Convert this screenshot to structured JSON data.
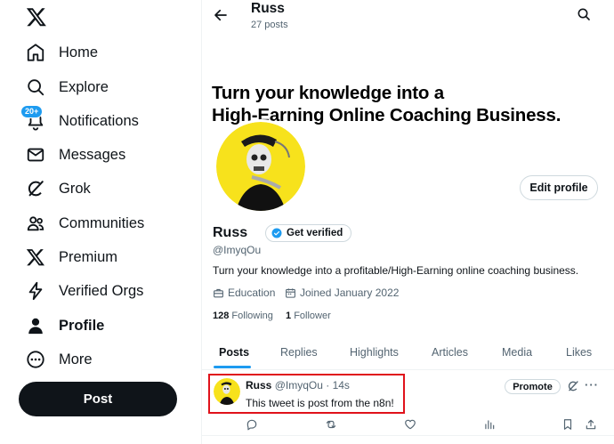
{
  "sidebar": {
    "logo_icon": "x-logo-icon",
    "items": [
      {
        "label": "Home",
        "icon": "home-icon"
      },
      {
        "label": "Explore",
        "icon": "search-icon"
      },
      {
        "label": "Notifications",
        "icon": "bell-icon",
        "badge": "20+"
      },
      {
        "label": "Messages",
        "icon": "envelope-icon"
      },
      {
        "label": "Grok",
        "icon": "grok-icon"
      },
      {
        "label": "Communities",
        "icon": "people-icon"
      },
      {
        "label": "Premium",
        "icon": "x-logo-icon"
      },
      {
        "label": "Verified Orgs",
        "icon": "lightning-icon"
      },
      {
        "label": "Profile",
        "icon": "person-icon"
      },
      {
        "label": "More",
        "icon": "more-circle-icon"
      }
    ],
    "post_label": "Post"
  },
  "header": {
    "name": "Russ",
    "post_count": "27 posts"
  },
  "banner": {
    "line1": "Turn your knowledge into a",
    "line2": "High-Earning Online Coaching Business."
  },
  "profile": {
    "edit_label": "Edit profile",
    "name": "Russ",
    "get_verified_label": "Get verified",
    "handle": "@ImyqOu",
    "bio": "Turn your knowledge into a profitable/High-Earning online coaching business.",
    "category": "Education",
    "joined": "Joined January 2022",
    "following_count": "128",
    "following_label": "Following",
    "followers_count": "1",
    "followers_label": "Follower"
  },
  "tabs": [
    "Posts",
    "Replies",
    "Highlights",
    "Articles",
    "Media",
    "Likes"
  ],
  "tweet": {
    "name": "Russ",
    "handle": "@ImyqOu",
    "time": "· 14s",
    "text": "This tweet is post from the n8n!",
    "promote_label": "Promote",
    "more_label": "···"
  },
  "colors": {
    "accent": "#1d9bf0",
    "avatar_bg": "#f7e21c",
    "highlight_border": "#e0121b"
  }
}
